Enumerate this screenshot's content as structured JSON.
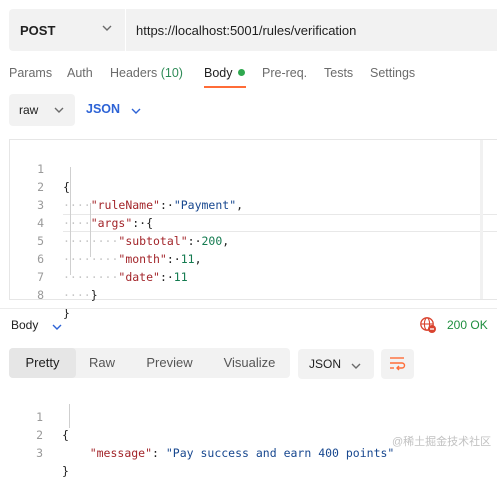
{
  "request": {
    "method": "POST",
    "url": "https://localhost:5001/rules/verification",
    "tabs": [
      {
        "label": "Params"
      },
      {
        "label": "Auth"
      },
      {
        "label": "Headers",
        "count": "(10)"
      },
      {
        "label": "Body"
      },
      {
        "label": "Pre-req."
      },
      {
        "label": "Tests"
      },
      {
        "label": "Settings"
      }
    ],
    "body_type": "raw",
    "body_format": "JSON"
  },
  "request_body": {
    "line_numbers": [
      "1",
      "2",
      "3",
      "4",
      "5",
      "6",
      "7",
      "8"
    ],
    "open_brace": "{",
    "close_brace": "}",
    "key_ruleName": "\"ruleName\"",
    "val_ruleName": "\"Payment\"",
    "key_args": "\"args\"",
    "key_subtotal": "\"subtotal\"",
    "val_subtotal": "200",
    "key_month": "\"month\"",
    "val_month": "11",
    "key_date": "\"date\"",
    "val_date": "11"
  },
  "response": {
    "body_label": "Body",
    "status": "200 OK",
    "tabs": [
      {
        "label": "Pretty"
      },
      {
        "label": "Raw"
      },
      {
        "label": "Preview"
      },
      {
        "label": "Visualize"
      }
    ],
    "format": "JSON",
    "line_numbers": [
      "1",
      "2",
      "3"
    ],
    "open_brace": "{",
    "close_brace": "}",
    "key_message": "\"message\"",
    "val_message": "\"Pay success and earn 400 points\""
  },
  "watermark": "@稀土掘金技术社区",
  "colors": {
    "accent": "#ff6c37",
    "link_blue": "#2d63d6",
    "status_green": "#1e8e3e",
    "active_dot": "#2fa84f",
    "json_key": "#a3262b",
    "json_string": "#17478f",
    "json_number": "#137a4f"
  },
  "icons": {
    "method_dropdown": "chevron-down-icon",
    "body_status": "globe-no-entry-icon",
    "wrap": "wrap-lines-icon"
  }
}
